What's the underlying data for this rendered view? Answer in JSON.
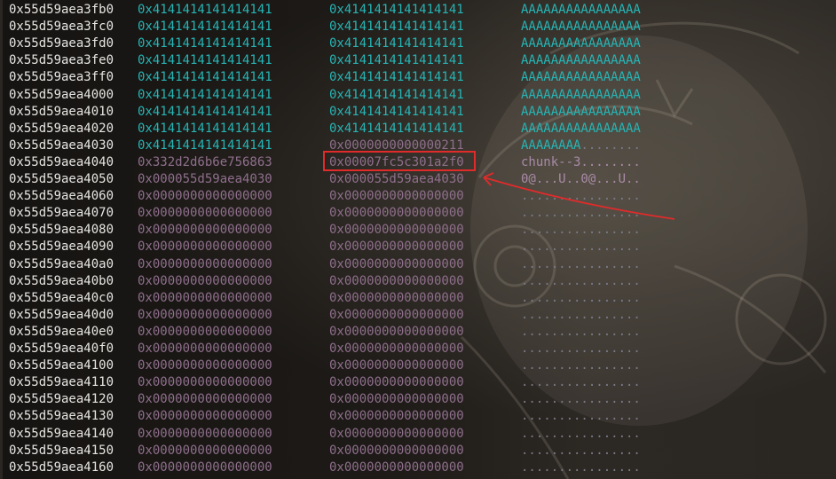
{
  "rows": [
    {
      "addr": "0x55d59aea3fb0",
      "c1": "0x4141414141414141",
      "c2": "0x4141414141414141",
      "asc": "AAAAAAAAAAAAAAAA",
      "c1_color": "teal",
      "c2_color": "teal",
      "asc_color": "teal"
    },
    {
      "addr": "0x55d59aea3fc0",
      "c1": "0x4141414141414141",
      "c2": "0x4141414141414141",
      "asc": "AAAAAAAAAAAAAAAA",
      "c1_color": "teal",
      "c2_color": "teal",
      "asc_color": "teal"
    },
    {
      "addr": "0x55d59aea3fd0",
      "c1": "0x4141414141414141",
      "c2": "0x4141414141414141",
      "asc": "AAAAAAAAAAAAAAAA",
      "c1_color": "teal",
      "c2_color": "teal",
      "asc_color": "teal"
    },
    {
      "addr": "0x55d59aea3fe0",
      "c1": "0x4141414141414141",
      "c2": "0x4141414141414141",
      "asc": "AAAAAAAAAAAAAAAA",
      "c1_color": "teal",
      "c2_color": "teal",
      "asc_color": "teal"
    },
    {
      "addr": "0x55d59aea3ff0",
      "c1": "0x4141414141414141",
      "c2": "0x4141414141414141",
      "asc": "AAAAAAAAAAAAAAAA",
      "c1_color": "teal",
      "c2_color": "teal",
      "asc_color": "teal"
    },
    {
      "addr": "0x55d59aea4000",
      "c1": "0x4141414141414141",
      "c2": "0x4141414141414141",
      "asc": "AAAAAAAAAAAAAAAA",
      "c1_color": "teal",
      "c2_color": "teal",
      "asc_color": "teal"
    },
    {
      "addr": "0x55d59aea4010",
      "c1": "0x4141414141414141",
      "c2": "0x4141414141414141",
      "asc": "AAAAAAAAAAAAAAAA",
      "c1_color": "teal",
      "c2_color": "teal",
      "asc_color": "teal"
    },
    {
      "addr": "0x55d59aea4020",
      "c1": "0x4141414141414141",
      "c2": "0x4141414141414141",
      "asc": "AAAAAAAAAAAAAAAA",
      "c1_color": "teal",
      "c2_color": "teal",
      "asc_color": "teal"
    },
    {
      "addr": "0x55d59aea4030",
      "c1": "0x4141414141414141",
      "c2": "0x0000000000000211",
      "asc": "AAAAAAAA........",
      "c1_color": "teal",
      "c2_color": "grey",
      "asc_color": "mixed",
      "asc_teal": "AAAAAAAA",
      "asc_rest": "........"
    },
    {
      "addr": "0x55d59aea4040",
      "c1": "0x332d2d6b6e756863",
      "c2": "0x00007fc5c301a2f0",
      "asc": "chunk--3........",
      "c1_color": "grey",
      "c2_color": "grey",
      "asc_color": "grey"
    },
    {
      "addr": "0x55d59aea4050",
      "c1": "0x000055d59aea4030",
      "c2": "0x000055d59aea4030",
      "asc": "0@...U..0@...U..",
      "c1_color": "grey",
      "c2_color": "grey",
      "asc_color": "grey"
    },
    {
      "addr": "0x55d59aea4060",
      "c1": "0x0000000000000000",
      "c2": "0x0000000000000000",
      "asc": "................",
      "c1_color": "grey",
      "c2_color": "grey",
      "asc_color": "dots"
    },
    {
      "addr": "0x55d59aea4070",
      "c1": "0x0000000000000000",
      "c2": "0x0000000000000000",
      "asc": "................",
      "c1_color": "grey",
      "c2_color": "grey",
      "asc_color": "dots"
    },
    {
      "addr": "0x55d59aea4080",
      "c1": "0x0000000000000000",
      "c2": "0x0000000000000000",
      "asc": "................",
      "c1_color": "grey",
      "c2_color": "grey",
      "asc_color": "dots"
    },
    {
      "addr": "0x55d59aea4090",
      "c1": "0x0000000000000000",
      "c2": "0x0000000000000000",
      "asc": "................",
      "c1_color": "grey",
      "c2_color": "grey",
      "asc_color": "dots"
    },
    {
      "addr": "0x55d59aea40a0",
      "c1": "0x0000000000000000",
      "c2": "0x0000000000000000",
      "asc": "................",
      "c1_color": "grey",
      "c2_color": "grey",
      "asc_color": "dots"
    },
    {
      "addr": "0x55d59aea40b0",
      "c1": "0x0000000000000000",
      "c2": "0x0000000000000000",
      "asc": "................",
      "c1_color": "grey",
      "c2_color": "grey",
      "asc_color": "dots"
    },
    {
      "addr": "0x55d59aea40c0",
      "c1": "0x0000000000000000",
      "c2": "0x0000000000000000",
      "asc": "................",
      "c1_color": "grey",
      "c2_color": "grey",
      "asc_color": "dots"
    },
    {
      "addr": "0x55d59aea40d0",
      "c1": "0x0000000000000000",
      "c2": "0x0000000000000000",
      "asc": "................",
      "c1_color": "grey",
      "c2_color": "grey",
      "asc_color": "dots"
    },
    {
      "addr": "0x55d59aea40e0",
      "c1": "0x0000000000000000",
      "c2": "0x0000000000000000",
      "asc": "................",
      "c1_color": "grey",
      "c2_color": "grey",
      "asc_color": "dots"
    },
    {
      "addr": "0x55d59aea40f0",
      "c1": "0x0000000000000000",
      "c2": "0x0000000000000000",
      "asc": "................",
      "c1_color": "grey",
      "c2_color": "grey",
      "asc_color": "dots"
    },
    {
      "addr": "0x55d59aea4100",
      "c1": "0x0000000000000000",
      "c2": "0x0000000000000000",
      "asc": "................",
      "c1_color": "grey",
      "c2_color": "grey",
      "asc_color": "dots"
    },
    {
      "addr": "0x55d59aea4110",
      "c1": "0x0000000000000000",
      "c2": "0x0000000000000000",
      "asc": "................",
      "c1_color": "grey",
      "c2_color": "grey",
      "asc_color": "dots"
    },
    {
      "addr": "0x55d59aea4120",
      "c1": "0x0000000000000000",
      "c2": "0x0000000000000000",
      "asc": "................",
      "c1_color": "grey",
      "c2_color": "grey",
      "asc_color": "dots"
    },
    {
      "addr": "0x55d59aea4130",
      "c1": "0x0000000000000000",
      "c2": "0x0000000000000000",
      "asc": "................",
      "c1_color": "grey",
      "c2_color": "grey",
      "asc_color": "dots"
    },
    {
      "addr": "0x55d59aea4140",
      "c1": "0x0000000000000000",
      "c2": "0x0000000000000000",
      "asc": "................",
      "c1_color": "grey",
      "c2_color": "grey",
      "asc_color": "dots"
    },
    {
      "addr": "0x55d59aea4150",
      "c1": "0x0000000000000000",
      "c2": "0x0000000000000000",
      "asc": "................",
      "c1_color": "grey",
      "c2_color": "grey",
      "asc_color": "dots"
    },
    {
      "addr": "0x55d59aea4160",
      "c1": "0x0000000000000000",
      "c2": "0x0000000000000000",
      "asc": "................",
      "c1_color": "grey",
      "c2_color": "grey",
      "asc_color": "dots"
    }
  ],
  "colors": {
    "teal": "#26b5b5",
    "grey": "#8f6f8c",
    "address": "#e8e6e3",
    "highlight": "#e02b2b"
  }
}
